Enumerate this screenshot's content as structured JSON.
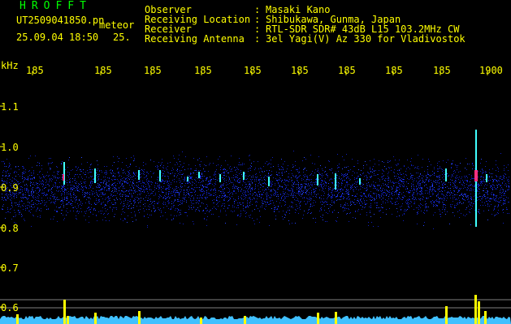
{
  "header": {
    "logo": "HROFFT",
    "filename": "UT2509041850.pn",
    "meteor_label": "meteor",
    "datetime": "25.09.04 18:50",
    "count": "25."
  },
  "info": {
    "labels": [
      "Observer",
      "Receiving Location",
      "Receiver",
      "Receiving Antenna"
    ],
    "separator": ":",
    "values": [
      "Masaki Kano",
      "Shibukawa, Gunma, Japan",
      "RTL-SDR SDR# 43dB L15 103.2MHz CW",
      "3el Yagi(V) Az 330 for Vladivostok"
    ]
  },
  "axes": {
    "y_unit": "kHz",
    "y_ticks": [
      "1.1",
      "1.0",
      "0.9",
      "0.8",
      "0.7",
      "0.6"
    ],
    "x_ticks": [
      "185",
      "185",
      "185",
      "185",
      "185",
      "185",
      "185",
      "185",
      "185",
      "1900"
    ]
  },
  "colors": {
    "text": "#ffff00",
    "logo": "#00ff00",
    "noise": "#1020c0",
    "echo": "#40ffff",
    "strong": "#ff3080",
    "bars": "#ffff00",
    "baseline": "#40c0ff"
  }
}
